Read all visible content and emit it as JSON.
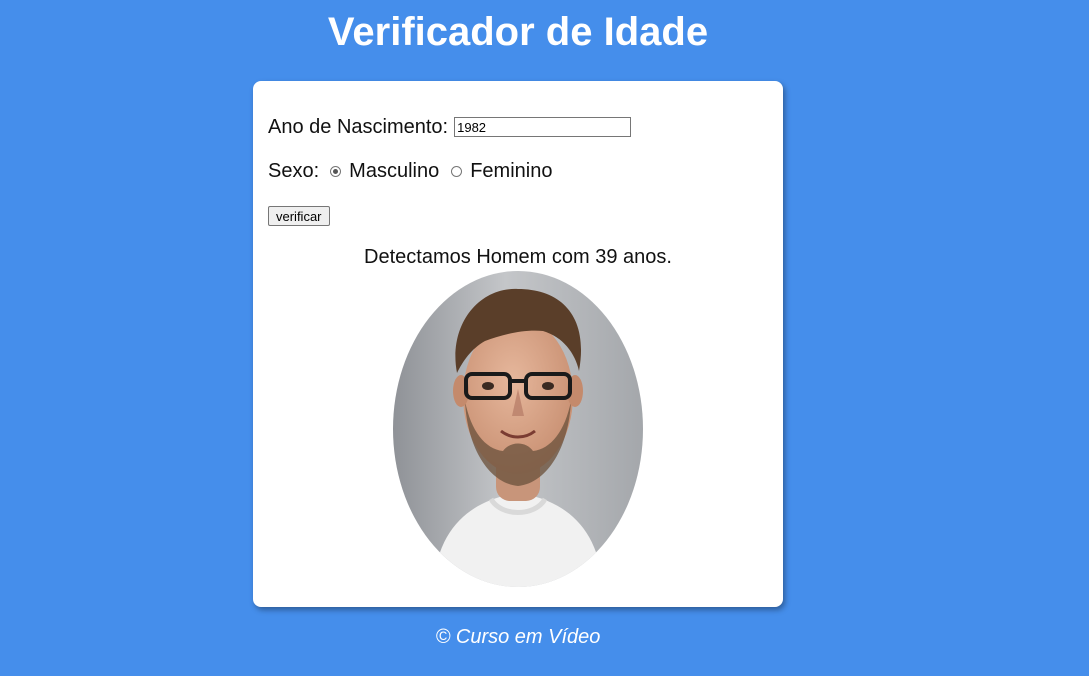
{
  "header": {
    "title": "Verificador de Idade"
  },
  "form": {
    "birth_year_label": "Ano de Nascimento:",
    "birth_year_value": "1982",
    "sex_label": "Sexo:",
    "options": [
      "Masculino",
      "Feminino"
    ],
    "selected": "Masculino",
    "verify_label": "verificar"
  },
  "result": {
    "text": "Detectamos Homem com 39 anos.",
    "photo": "man-portrait-oval"
  },
  "footer": {
    "text": "© Curso em Vídeo"
  },
  "colors": {
    "background": "#458eeb",
    "card": "#ffffff",
    "text": "#111111"
  }
}
